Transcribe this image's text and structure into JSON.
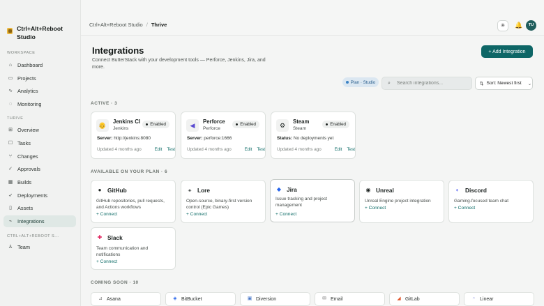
{
  "brand": {
    "name": "Ctrl+Alt+Reboot Studio"
  },
  "sidebar": {
    "workspace_label": "WORKSPACE",
    "workspace_items": [
      {
        "label": "Dashboard",
        "icon": "home-icon"
      },
      {
        "label": "Projects",
        "icon": "folder-icon"
      },
      {
        "label": "Analytics",
        "icon": "analytics-icon"
      },
      {
        "label": "Monitoring",
        "icon": "bell-icon"
      }
    ],
    "thrive_label": "THRIVE",
    "thrive_items": [
      {
        "label": "Overview",
        "icon": "overview-icon"
      },
      {
        "label": "Tasks",
        "icon": "tasks-icon"
      },
      {
        "label": "Changes",
        "icon": "changes-icon"
      },
      {
        "label": "Approvals",
        "icon": "check-icon"
      },
      {
        "label": "Builds",
        "icon": "builds-icon"
      },
      {
        "label": "Deployments",
        "icon": "rocket-icon"
      },
      {
        "label": "Assets",
        "icon": "file-icon"
      },
      {
        "label": "Integrations",
        "icon": "plug-icon",
        "active": true
      }
    ],
    "org_label": "CTRL+ALT+REBOOT S...",
    "org_items": [
      {
        "label": "Team",
        "icon": "team-icon"
      }
    ]
  },
  "topbar": {
    "breadcrumb": [
      "Ctrl+Alt+Reboot Studio",
      "/",
      "Thrive"
    ],
    "avatar_initials": "TU"
  },
  "page": {
    "title": "Integrations",
    "subtitle": "Connect ButterStack with your development tools — Perforce, Jenkins, Jira, and more.",
    "add_button": "+  Add Integration",
    "plan_pill": "Plan · Studio",
    "search_placeholder": "Search integrations...",
    "sort_label": "Sort: Newest first"
  },
  "active": {
    "label": "ACTIVE · 3",
    "cards": [
      {
        "name": "Jenkins CI",
        "sub": "Jenkins",
        "status": "Enabled",
        "detail_key": "Server:",
        "detail_value": "http://jenkins:8080",
        "updated": "Updated 4 months ago",
        "edit": "Edit",
        "test": "Test"
      },
      {
        "name": "Perforce",
        "sub": "Perforce",
        "status": "Enabled",
        "detail_key": "Server:",
        "detail_value": "perforce:1666",
        "updated": "Updated 4 months ago",
        "edit": "Edit",
        "test": "Test"
      },
      {
        "name": "Steam",
        "sub": "Steam",
        "status": "Enabled",
        "detail_key": "Status:",
        "detail_value": "No deployments yet",
        "updated": "Updated 4 months ago",
        "edit": "Edit",
        "test": "Test"
      }
    ]
  },
  "available": {
    "label": "AVAILABLE ON YOUR PLAN · 6",
    "cards": [
      {
        "name": "GitHub",
        "desc": "GitHub repositories, pull requests, and Actions workflows",
        "connect": "+ Connect"
      },
      {
        "name": "Lore",
        "desc": "Open-source, binary-first version control (Epic Games)",
        "connect": "+ Connect"
      },
      {
        "name": "Jira",
        "desc": "Issue tracking and project management",
        "connect": "+ Connect"
      },
      {
        "name": "Unreal",
        "desc": "Unreal Engine project integration",
        "connect": "+ Connect"
      },
      {
        "name": "Discord",
        "desc": "Gaming-focused team chat",
        "connect": "+ Connect"
      },
      {
        "name": "Slack",
        "desc": "Team communication and notifications",
        "connect": "+ Connect"
      }
    ]
  },
  "coming_soon": {
    "label": "COMING SOON · 10",
    "items": [
      "Asana",
      "BitBucket",
      "Diversion",
      "Email",
      "GitLab",
      "Linear"
    ]
  }
}
